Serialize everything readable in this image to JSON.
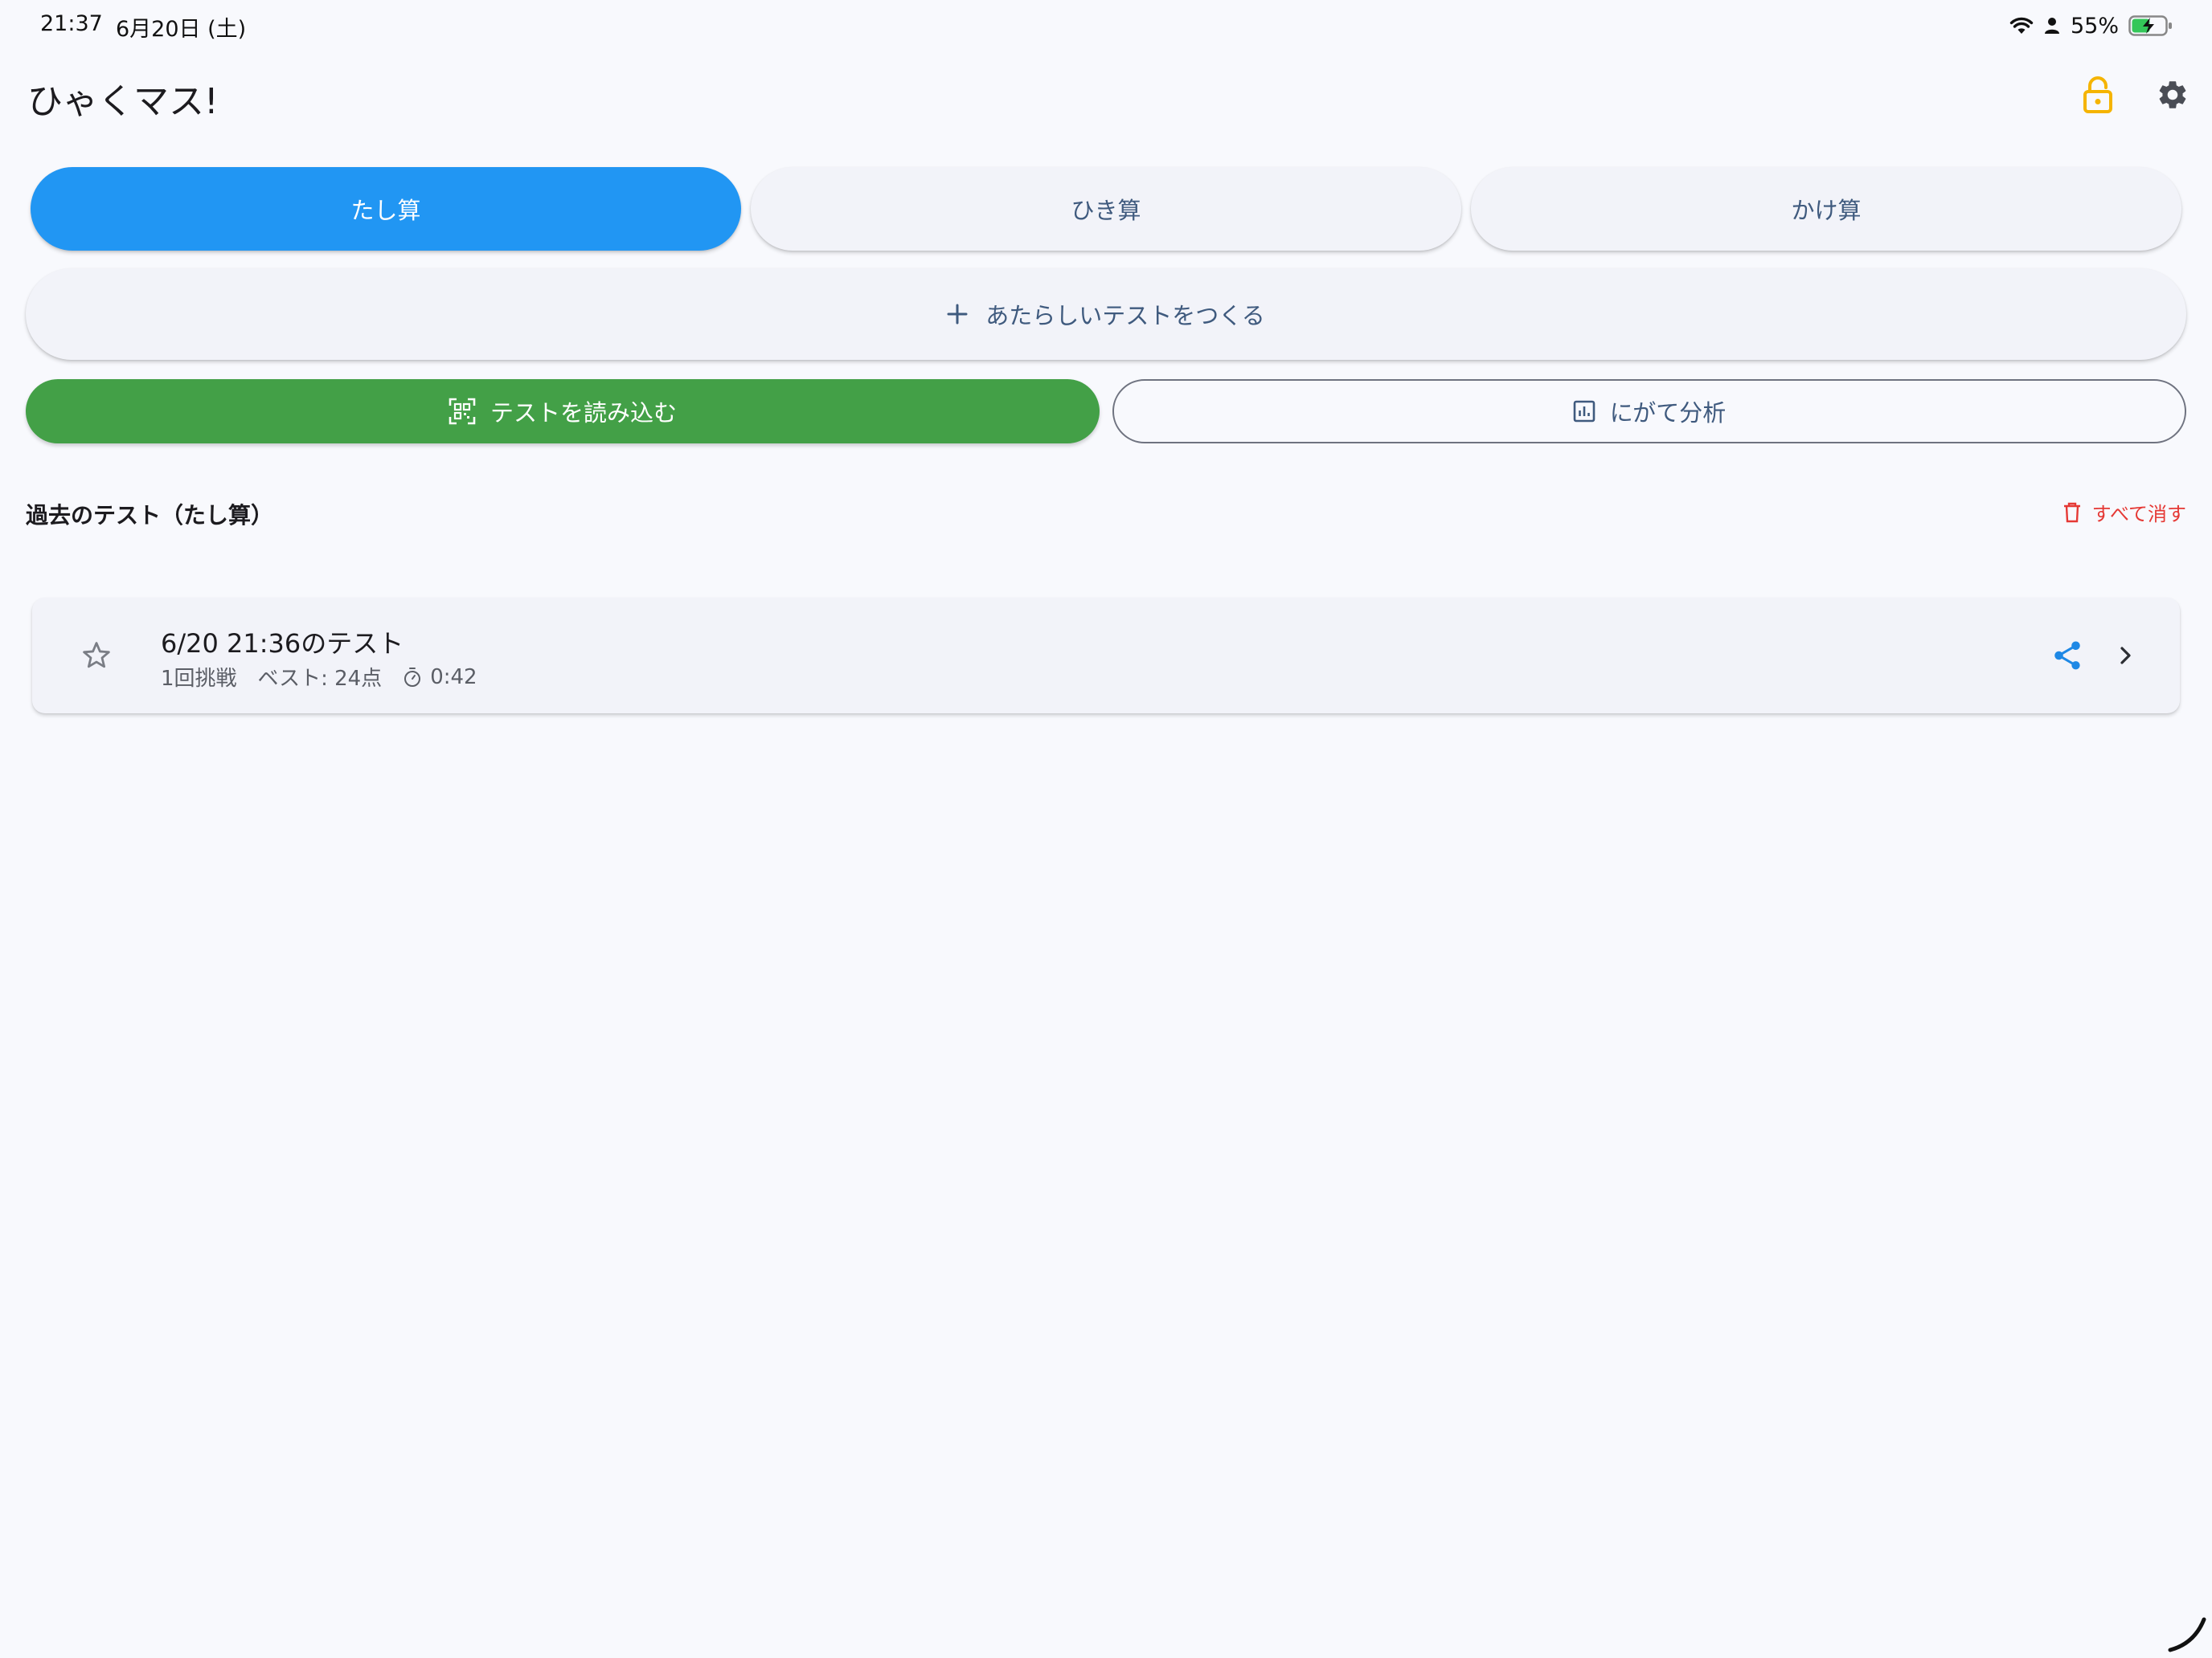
{
  "status_bar": {
    "time": "21:37",
    "date": "6月20日 (土)",
    "battery_percent": "55%",
    "battery_level": 0.55,
    "icons": [
      "wifi-icon",
      "person-icon",
      "battery-charging-icon"
    ]
  },
  "app_bar": {
    "title": "ひゃくマス!",
    "icons": [
      "lock-open-icon",
      "gear-icon"
    ],
    "lock_color": "#f5b400"
  },
  "tabs": [
    {
      "label": "たし算",
      "active": true
    },
    {
      "label": "ひき算",
      "active": false
    },
    {
      "label": "かけ算",
      "active": false
    }
  ],
  "actions": {
    "new_test": "あたらしいテストをつくる",
    "scan_test": "テストを読み込む",
    "analysis": "にがて分析"
  },
  "history": {
    "section_title": "過去のテスト（たし算）",
    "clear_all": "すべて消す",
    "items": [
      {
        "title": "6/20 21:36のテスト",
        "attempts": "1回挑戦",
        "best": "ベスト: 24点",
        "time": "0:42",
        "starred": false
      }
    ]
  },
  "colors": {
    "primary": "#2196f3",
    "success": "#43a047",
    "danger": "#e53935",
    "background": "#f8f9fd"
  }
}
